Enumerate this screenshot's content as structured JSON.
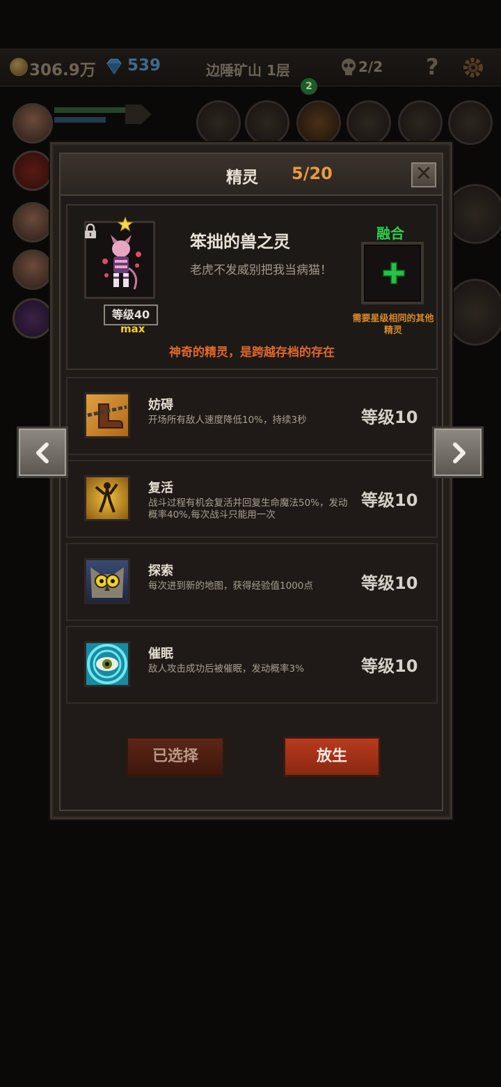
{
  "hud": {
    "gold": "306.9万",
    "gems": "539",
    "map_title": "边陲矿山 1层",
    "skull_count": "2/2",
    "help": "?",
    "badge": "2"
  },
  "dialog": {
    "title": "精灵",
    "count": "5/20",
    "close": "✕"
  },
  "pet": {
    "name": "笨拙的兽之灵",
    "quote": "老虎不发威别把我当病猫！",
    "level": "等级40",
    "max": "max",
    "fuse_label": "融合",
    "fuse_hint": "需要星级相同的其他精灵",
    "description": "神奇的精灵，是跨越存档的存在"
  },
  "skills": [
    {
      "name": "妨碍",
      "desc": "开场所有敌人速度降低10%，持续3秒",
      "level": "等级10",
      "icon": "chained-boot-icon"
    },
    {
      "name": "复活",
      "desc": "战斗过程有机会复活并回复生命魔法50%，发动概率40%,每次战斗只能用一次",
      "level": "等级10",
      "icon": "revive-figure-icon"
    },
    {
      "name": "探索",
      "desc": "每次进到新的地图，获得经验值1000点",
      "level": "等级10",
      "icon": "owl-icon"
    },
    {
      "name": "催眠",
      "desc": "敌人攻击成功后被催眠，发动概率3%",
      "level": "等级10",
      "icon": "hypno-eye-icon"
    }
  ],
  "buttons": {
    "selected": "已选择",
    "release": "放生"
  },
  "colors": {
    "accent_orange": "#e79c3e",
    "fuse_green": "#2ecf4b",
    "desc_red": "#e0682a",
    "max_yellow": "#f2d024",
    "release_red": "#b83a1e"
  }
}
